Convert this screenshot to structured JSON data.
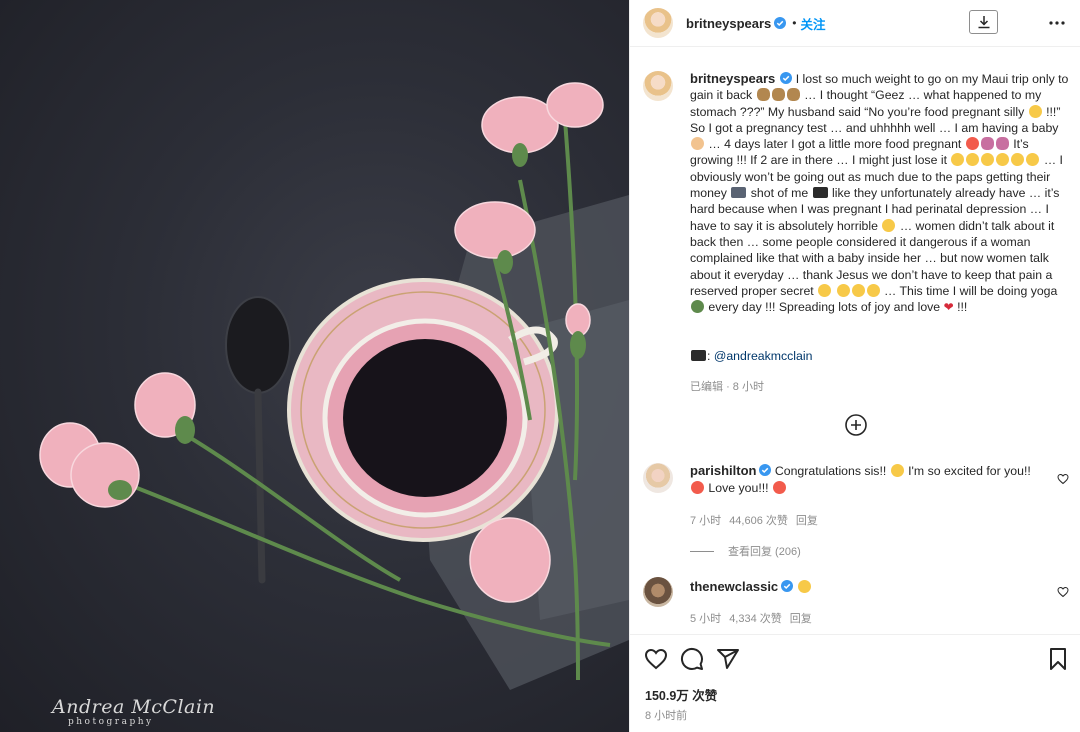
{
  "photo": {
    "alt": "Photo",
    "watermark_name": "Andrea McClain",
    "watermark_sub": "photography"
  },
  "header": {
    "username": "britneyspears",
    "dot": "•",
    "follow_label": "关注",
    "icons": [
      "verified-badge-icon",
      "download-icon",
      "more-options-icon"
    ]
  },
  "caption": {
    "username": "britneyspears",
    "segments": [
      "I lost so much weight to go on my Maui trip only to gain it back",
      "… I thought “Geez … what happened to my stomach ???” My husband said “No you’re food pregnant silly",
      "!!!” So I got a pregnancy test … and uhhhhh well … I am having a baby",
      "… 4 days later I got a little more food pregnant",
      "It’s growing !!! If 2 are in there … I might just lose it",
      "… I obviously won’t be going out as much due to the paps getting their money",
      "shot of me",
      "like they unfortunately already have … it’s hard because when I was pregnant I had perinatal depression … I have to say it is absolutely horrible",
      "… women didn’t talk about it back then … some people considered it dangerous if a woman complained like that with a baby inside her … but now women talk about it everyday … thank Jesus we don’t have to keep that pain a reserved proper secret",
      "… This time I will be doing yoga",
      "every day !!! Spreading lots of joy and love",
      "!!!"
    ],
    "credit_handle": "@andreakmcclain",
    "edited_label": "已编辑",
    "dot": "·",
    "edited_time": "8 小时"
  },
  "comments": [
    {
      "username": "parishilton",
      "text_a": "Congratulations sis!!",
      "text_b": "I'm so excited for you!!",
      "text_c": "Love you!!!",
      "time": "7 小时",
      "likes": "44,606 次赞",
      "reply_label": "回复",
      "view_replies": "查看回复 (206)"
    },
    {
      "username": "thenewclassic",
      "time": "5 小时",
      "likes": "4,334 次赞",
      "reply_label": "回复"
    }
  ],
  "footer": {
    "likes": "150.9万 次赞",
    "time": "8 小时前",
    "icons": [
      "like-heart-icon",
      "comment-icon",
      "share-icon",
      "save-bookmark-icon"
    ]
  },
  "colors": {
    "accent": "#0095f6",
    "verified": "#3897f0",
    "link": "#00376b",
    "muted": "#8e8e8e"
  }
}
